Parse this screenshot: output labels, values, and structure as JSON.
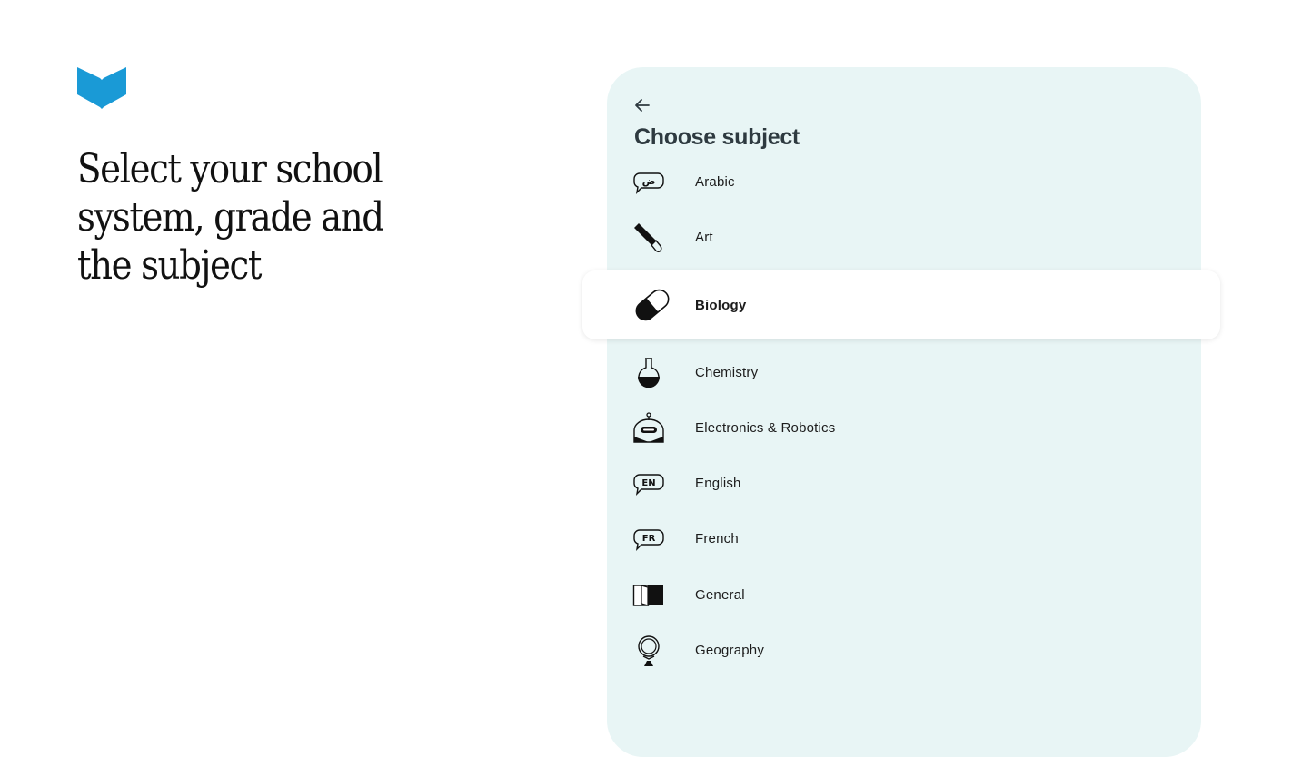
{
  "brand": {
    "accent": "#1a9ad6"
  },
  "hero": {
    "line1": "Select your school",
    "line2": "system, grade and",
    "line3": "the subject"
  },
  "panel": {
    "title": "Choose subject",
    "background": "#e8f5f5",
    "subjects": [
      {
        "label": "Arabic",
        "icon": "arabic-speech-bubble-icon",
        "icon_text": "ض",
        "selected": false
      },
      {
        "label": "Art",
        "icon": "paintbrush-icon",
        "selected": false
      },
      {
        "label": "Biology",
        "icon": "capsule-icon",
        "selected": true
      },
      {
        "label": "Chemistry",
        "icon": "flask-icon",
        "selected": false
      },
      {
        "label": "Electronics & Robotics",
        "icon": "robot-icon",
        "selected": false
      },
      {
        "label": "English",
        "icon": "english-speech-bubble-icon",
        "icon_text": "EN",
        "selected": false
      },
      {
        "label": "French",
        "icon": "french-speech-bubble-icon",
        "icon_text": "FR",
        "selected": false
      },
      {
        "label": "General",
        "icon": "open-book-icon",
        "selected": false
      },
      {
        "label": "Geography",
        "icon": "globe-icon",
        "selected": false
      }
    ]
  }
}
